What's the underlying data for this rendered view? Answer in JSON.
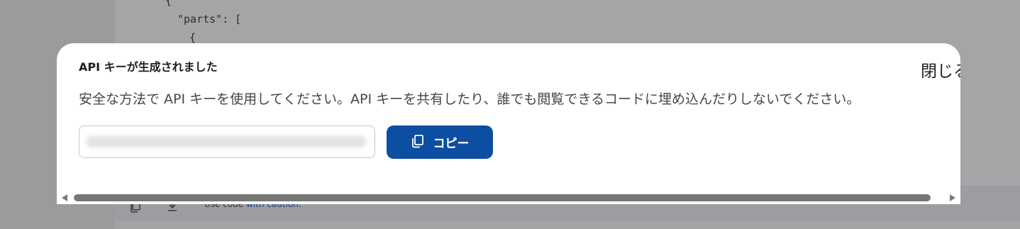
{
  "background": {
    "code_lines": [
      "{",
      "\"parts\": [",
      "{"
    ],
    "footer_caution_prefix": "Use code",
    "footer_caution_link": "with caution."
  },
  "dialog": {
    "title": "API キーが生成されました",
    "close_label": "閉じる",
    "description": "安全な方法で API キーを使用してください。API キーを共有したり、誰でも閲覧できるコードに埋め込んだりしないでください。",
    "key_field": {
      "value": "",
      "obscured": true
    },
    "copy_button": {
      "label": "コピー",
      "icon": "copy-icon"
    }
  },
  "colors": {
    "primary": "#0b4ea2",
    "overlay": "#a3a3a5"
  }
}
